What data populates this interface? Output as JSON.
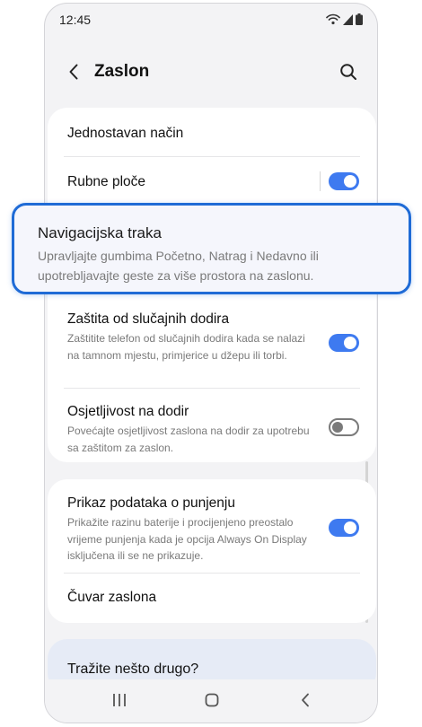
{
  "status_bar": {
    "time": "12:45"
  },
  "app_bar": {
    "title": "Zaslon"
  },
  "settings": [
    {
      "title": "Jednostavan način"
    },
    {
      "title": "Rubne ploče",
      "toggle": "on"
    },
    {
      "title": "Zaštita od slučajnih dodira",
      "desc": "Zaštitite telefon od slučajnih dodira kada se nalazi na tamnom mjestu, primjerice u džepu ili torbi.",
      "toggle": "on"
    },
    {
      "title": "Osjetljivost na dodir",
      "desc": "Povećajte osjetljivost zaslona na dodir za upotrebu sa zaštitom za zaslon.",
      "toggle": "off"
    },
    {
      "title": "Prikaz podataka o punjenju",
      "desc": "Prikažite razinu baterije i procijenjeno preostalo vrijeme punjenja kada je opcija Always On Display isključena ili se ne prikazuje.",
      "toggle": "on"
    },
    {
      "title": "Čuvar zaslona"
    }
  ],
  "highlight": {
    "title": "Navigacijska traka",
    "desc": "Upravljajte gumbima Početno, Natrag i Nedavno ili upotrebljavajte geste za više prostora na zaslonu."
  },
  "suggest": {
    "label": "Tražite nešto drugo?"
  },
  "colors": {
    "accent": "#3e7af0",
    "highlight_border": "#1f6bd6",
    "background": "#f3f3f5",
    "suggest_bg": "#e6ebf6"
  },
  "icons": {
    "back": "chevron-left-icon",
    "search": "search-icon",
    "wifi": "wifi-icon",
    "signal": "signal-icon",
    "battery": "battery-icon",
    "recents": "recents-icon",
    "home": "home-icon",
    "nav_back": "nav-back-icon"
  }
}
